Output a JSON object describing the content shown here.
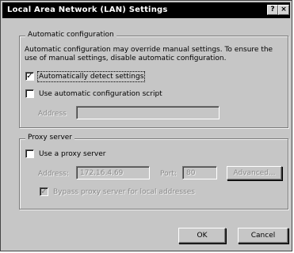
{
  "window": {
    "title": "Local Area Network (LAN) Settings",
    "help_glyph": "?",
    "close_glyph": "×"
  },
  "automatic_configuration": {
    "legend": "Automatic configuration",
    "description": "Automatic configuration may override manual settings.  To ensure the use of manual settings, disable automatic configuration.",
    "auto_detect": {
      "label": "Automatically detect settings",
      "checked": true,
      "mark": "✓"
    },
    "use_script": {
      "label": "Use automatic configuration script",
      "checked": false
    },
    "address_label": "Address",
    "address_value": ""
  },
  "proxy_server": {
    "legend": "Proxy server",
    "use_proxy": {
      "label": "Use a proxy server",
      "checked": false
    },
    "address_label": "Address:",
    "address_value": "172.16.4.69",
    "port_label": "Port:",
    "port_value": "80",
    "advanced_label": "Advanced...",
    "bypass": {
      "label": "Bypass proxy server for local addresses",
      "checked": true,
      "disabled": true,
      "mark": "✓"
    }
  },
  "buttons": {
    "ok": "OK",
    "cancel": "Cancel"
  },
  "colors": {
    "dialog_bg": "#c6c6c6",
    "titlebar_bg": "#000000",
    "titlebar_text": "#ffffff",
    "disabled_text": "#8a8a8a"
  }
}
